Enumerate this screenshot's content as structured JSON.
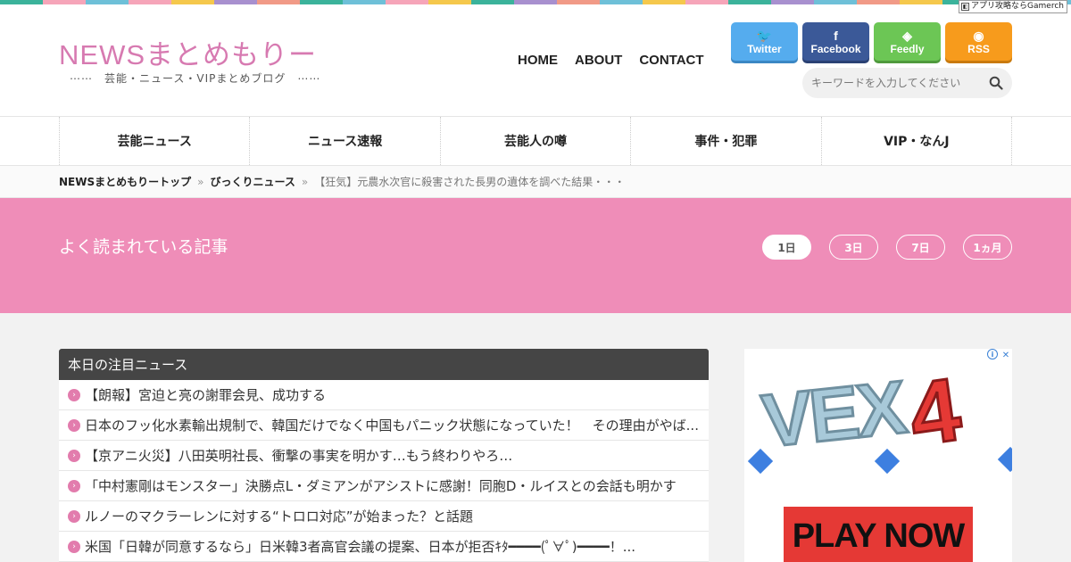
{
  "stripe_colors": [
    "#3bb39b",
    "#f6a5b9",
    "#6ec0d8",
    "#f6a5b9",
    "#f5c84c",
    "#a890cf",
    "#f19a87",
    "#3bb39b",
    "#6ec0d8",
    "#f6a5b9",
    "#f5c84c",
    "#3bb39b",
    "#a890cf",
    "#f19a87",
    "#6ec0d8",
    "#f5c84c",
    "#f6a5b9",
    "#3bb39b",
    "#a890cf",
    "#6ec0d8",
    "#f19a87",
    "#f5c84c",
    "#3bb39b",
    "#f6a5b9",
    "#6ec0d8"
  ],
  "ad_label": "アプリ攻略ならGamerch",
  "site": {
    "logo": "NEWSまとめもりー",
    "tagline": "⋯⋯　芸能・ニュース・VIPまとめブログ　⋯⋯"
  },
  "topnav": [
    "HOME",
    "ABOUT",
    "CONTACT"
  ],
  "social": [
    {
      "label": "Twitter",
      "icon": "twitter-icon",
      "glyph": "🐦",
      "color": "#55acee",
      "shadow": "#3b87c4"
    },
    {
      "label": "Facebook",
      "icon": "facebook-icon",
      "glyph": "f",
      "color": "#3b5998",
      "shadow": "#2a4173"
    },
    {
      "label": "Feedly",
      "icon": "feedly-icon",
      "glyph": "◈",
      "color": "#6cc655",
      "shadow": "#4f9a3d"
    },
    {
      "label": "RSS",
      "icon": "rss-icon",
      "glyph": "◉",
      "color": "#f79b1c",
      "shadow": "#c97a0e"
    }
  ],
  "search": {
    "placeholder": "キーワードを入力してください"
  },
  "categories": [
    "芸能ニュース",
    "ニュース速報",
    "芸能人の噂",
    "事件・犯罪",
    "VIP・なんJ"
  ],
  "breadcrumb": {
    "home": "NEWSまとめもりートップ",
    "category": "びっくりニュース",
    "current": "【狂気】元農水次官に殺害された長男の遺体を調べた結果・・・"
  },
  "popular": {
    "title": "よく読まれている記事",
    "tabs": [
      "1日",
      "3日",
      "7日",
      "1ヵ月"
    ],
    "active_tab": "1日"
  },
  "news": {
    "heading": "本日の注目ニュース",
    "items": [
      "【朗報】宮迫と亮の謝罪会見、成功する",
      "日本のフッ化水素輸出規制で、韓国だけでなく中国もパニック状態になっていた！　その理由がやば...",
      "【京アニ火災】八田英明社長、衝撃の事実を明かす…もう終わりやろ…",
      "「中村憲剛はモンスター」決勝点L・ダミアンがアシストに感謝！同胞D・ルイスとの会話も明かす",
      "ルノーのマクラーレンに対する“トロロ対応”が始まった？と話題",
      "米国「日韓が同意するなら」日米韓3者高官会議の提案、日本が拒否ｷﾀ━━━━(ﾟ∀ﾟ)━━━━！..."
    ]
  },
  "ad": {
    "title": "VEX",
    "number": "4",
    "cta": "PLAY NOW"
  }
}
